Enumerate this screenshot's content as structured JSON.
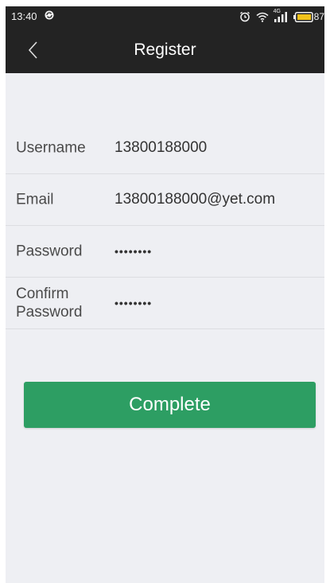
{
  "status_bar": {
    "time": "13:40",
    "network_label": "4G",
    "battery_level": "87"
  },
  "header": {
    "title": "Register"
  },
  "form": {
    "fields": [
      {
        "label": "Username",
        "value": "13800188000",
        "type": "text"
      },
      {
        "label": "Email",
        "value": "13800188000@yet.com",
        "type": "text"
      },
      {
        "label": "Password",
        "value": "••••••••",
        "type": "password"
      },
      {
        "label_line1": "Confirm",
        "label_line2": "Password",
        "value": "••••••••",
        "type": "password"
      }
    ]
  },
  "complete_button": {
    "label": "Complete"
  },
  "colors": {
    "bar_background": "#232323",
    "page_background": "#eeeff3",
    "button_green": "#2d9e63",
    "battery_fill": "#f2c21b"
  },
  "icons": {
    "sync": "sync-icon",
    "alarm": "alarm-icon",
    "wifi": "wifi-icon",
    "signal": "signal-icon",
    "battery": "battery-icon",
    "back": "back-chevron-icon"
  }
}
